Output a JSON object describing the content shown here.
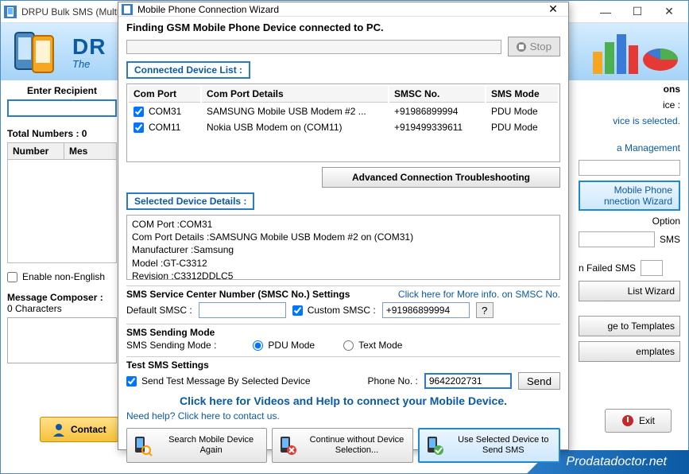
{
  "window": {
    "title": "DRPU Bulk SMS (Multi-Device Edition)",
    "brand": "DR",
    "tagline": "The",
    "footer_brand": "Prodatadoctor.net"
  },
  "left": {
    "recipient_label": "Enter Recipient",
    "total_numbers_label": "Total Numbers : 0",
    "col_number": "Number",
    "col_message": "Mes",
    "non_english_label": "Enable non-English",
    "composer_label": "Message Composer :",
    "char_count": "0 Characters",
    "contact_btn": "Contact"
  },
  "right": {
    "options_suffix": "ons",
    "device_suffix": "ice :",
    "no_device": "vice is selected.",
    "mgmt": "a Management",
    "wizard1": "Mobile Phone",
    "wizard2": "nnection  Wizard",
    "option_label": "Option",
    "sms_label": "SMS",
    "failed": "n Failed SMS",
    "list_wizard": "List Wizard",
    "to_templates": "ge to Templates",
    "templates": "emplates",
    "exit": "Exit"
  },
  "dialog": {
    "title": "Mobile Phone Connection Wizard",
    "finding": "Finding GSM Mobile Phone Device connected to PC.",
    "stop": "Stop",
    "connected_list": "Connected Device List :",
    "cols": {
      "port": "Com Port",
      "details": "Com Port Details",
      "smsc": "SMSC No.",
      "mode": "SMS Mode"
    },
    "rows": [
      {
        "port": "COM31",
        "details": "SAMSUNG Mobile USB Modem #2 ...",
        "smsc": "+91986899994",
        "mode": "PDU Mode"
      },
      {
        "port": "COM11",
        "details": "Nokia USB Modem on (COM11)",
        "smsc": "+919499339611",
        "mode": "PDU Mode"
      }
    ],
    "adv_btn": "Advanced Connection Troubleshooting",
    "selected_title": "Selected Device Details :",
    "details": {
      "l1": "COM Port :COM31",
      "l2": "Com Port Details :SAMSUNG Mobile USB Modem #2 on (COM31)",
      "l3": "Manufacturer :Samsung",
      "l4": "Model :GT-C3312",
      "l5": "Revision :C3312DDLC5"
    },
    "smsc_title": "SMS Service Center Number (SMSC No.) Settings",
    "smsc_info_link": "Click here for More info. on SMSC No.",
    "default_smsc_label": "Default SMSC :",
    "custom_smsc_label": "Custom SMSC :",
    "custom_smsc_value": "+91986899994",
    "q": "?",
    "mode_title": "SMS Sending Mode",
    "mode_label": "SMS Sending Mode :",
    "mode_pdu": "PDU Mode",
    "mode_text": "Text Mode",
    "test_title": "Test SMS Settings",
    "test_check": "Send Test Message By Selected Device",
    "phone_label": "Phone No. :",
    "phone_value": "9642202731",
    "send": "Send",
    "video_link": "Click here for Videos and Help to connect your Mobile Device.",
    "help_link": "Need help? Click here to contact us.",
    "btn_search": "Search Mobile Device Again",
    "btn_continue": "Continue without Device Selection...",
    "btn_use": "Use Selected Device to Send SMS"
  }
}
